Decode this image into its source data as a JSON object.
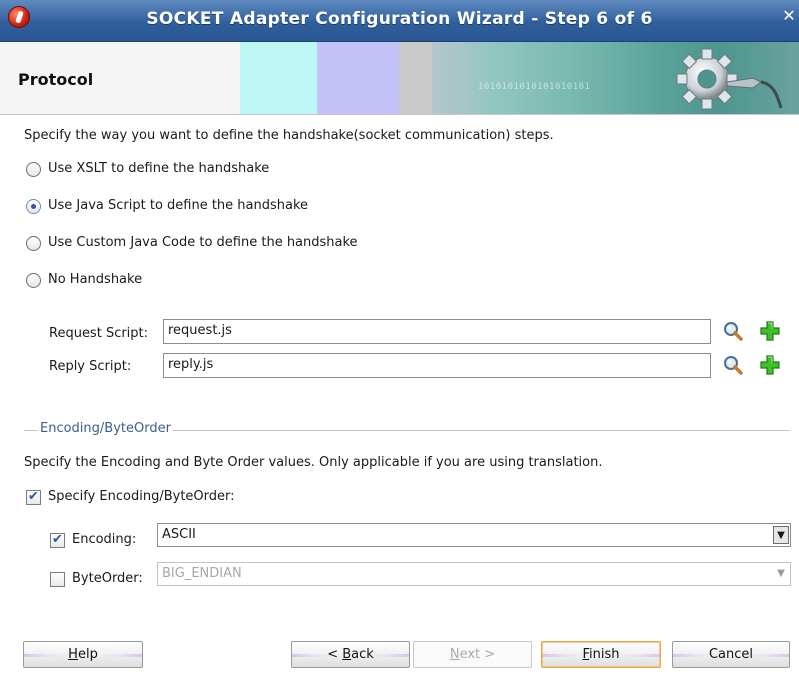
{
  "window": {
    "title": "SOCKET Adapter Configuration Wizard - Step 6 of 6",
    "close_glyph": "✕"
  },
  "banner": {
    "title": "Protocol",
    "binary_text": "1010101010101010101"
  },
  "handshake": {
    "description": "Specify the way you want to define the handshake(socket communication) steps.",
    "options": [
      {
        "label": "Use XSLT to define the handshake",
        "selected": false
      },
      {
        "label": "Use Java Script to define the handshake",
        "selected": true
      },
      {
        "label": "Use Custom Java Code to define the handshake",
        "selected": false
      },
      {
        "label": "No Handshake",
        "selected": false
      }
    ],
    "request_script": {
      "label": "Request Script:",
      "value": "request.js"
    },
    "reply_script": {
      "label": "Reply Script:",
      "value": "reply.js"
    }
  },
  "encoding_section": {
    "heading": "Encoding/ByteOrder",
    "description": "Specify the Encoding and Byte Order values. Only applicable if you are using translation.",
    "specify_checkbox": {
      "label": "Specify Encoding/ByteOrder:",
      "checked": true
    },
    "encoding": {
      "label": "Encoding:",
      "checked": true,
      "value": "ASCII"
    },
    "byte_order": {
      "label": "ByteOrder:",
      "checked": false,
      "value": "BIG_ENDIAN"
    }
  },
  "buttons": {
    "help": {
      "prefix": "",
      "mnemonic": "H",
      "suffix": "elp"
    },
    "back": {
      "prefix": "< ",
      "mnemonic": "B",
      "suffix": "ack"
    },
    "next": {
      "prefix": "",
      "mnemonic": "N",
      "suffix": "ext >"
    },
    "finish": {
      "prefix": "",
      "mnemonic": "F",
      "suffix": "inish"
    },
    "cancel": {
      "prefix": "",
      "mnemonic": "",
      "suffix": "Cancel"
    }
  },
  "icons": {
    "search": "search-icon",
    "add": "add-icon",
    "dropdown": "▼"
  },
  "colors": {
    "titlebar": "#2f5f9c",
    "section_heading": "#3a5e8f",
    "selection_accent": "#2a59a4",
    "focus_border": "#e5a44a"
  }
}
